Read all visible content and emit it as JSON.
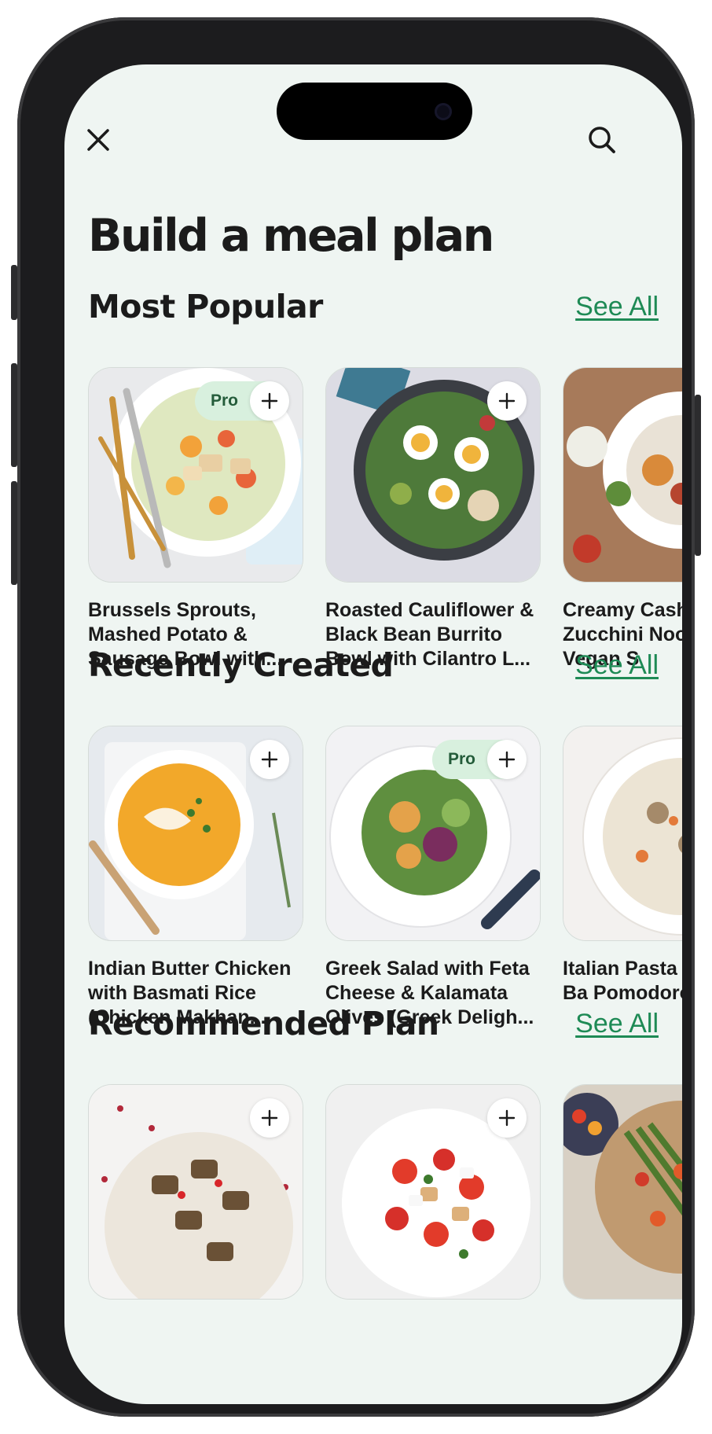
{
  "page": {
    "title": "Build a meal plan"
  },
  "sections": [
    {
      "title": "Most Popular",
      "see_all": "See All",
      "cards": [
        {
          "title": "Brussels Sprouts, Mashed Potato & Sausage Bowl with...",
          "badge": "Pro",
          "image": "caesar-salad-plate"
        },
        {
          "title": "Roasted Cauliflower & Black Bean Burrito Bowl with Cilantro L...",
          "badge": "",
          "image": "egg-greens-skillet"
        },
        {
          "title": "Creamy Cashew Zucchini Noodles with Vegan S",
          "badge": "",
          "image": "pasta-plate-table"
        }
      ]
    },
    {
      "title": "Recently Created",
      "see_all": "See All",
      "cards": [
        {
          "title": "Indian Butter Chicken with Basmati Rice (Chicken Makhan...",
          "badge": "",
          "image": "pumpkin-soup-bowl"
        },
        {
          "title": "Greek Salad with Feta Cheese & Kalamata Olives (Greek Deligh...",
          "badge": "Pro",
          "image": "leafy-salad-plate"
        },
        {
          "title": "Italian Pasta Tomato & Ba Pomodoro) a",
          "badge": "",
          "image": "clam-chowder-bowl"
        }
      ]
    },
    {
      "title": "Recommended Plan",
      "see_all": "See All",
      "cards": [
        {
          "title": "",
          "badge": "",
          "image": "eggplant-rolls-plate"
        },
        {
          "title": "",
          "badge": "",
          "image": "tomato-bread-salad"
        },
        {
          "title": "",
          "badge": "",
          "image": "green-beans-tomatoes"
        }
      ]
    }
  ],
  "icons": {
    "close": "close-icon",
    "search": "search-icon",
    "add": "plus-icon"
  },
  "colors": {
    "background": "#eff5f2",
    "accent": "#1e8a55",
    "pro_badge_bg": "#d8f0de",
    "pro_badge_text": "#245c3a",
    "text": "#1b1b1b"
  }
}
